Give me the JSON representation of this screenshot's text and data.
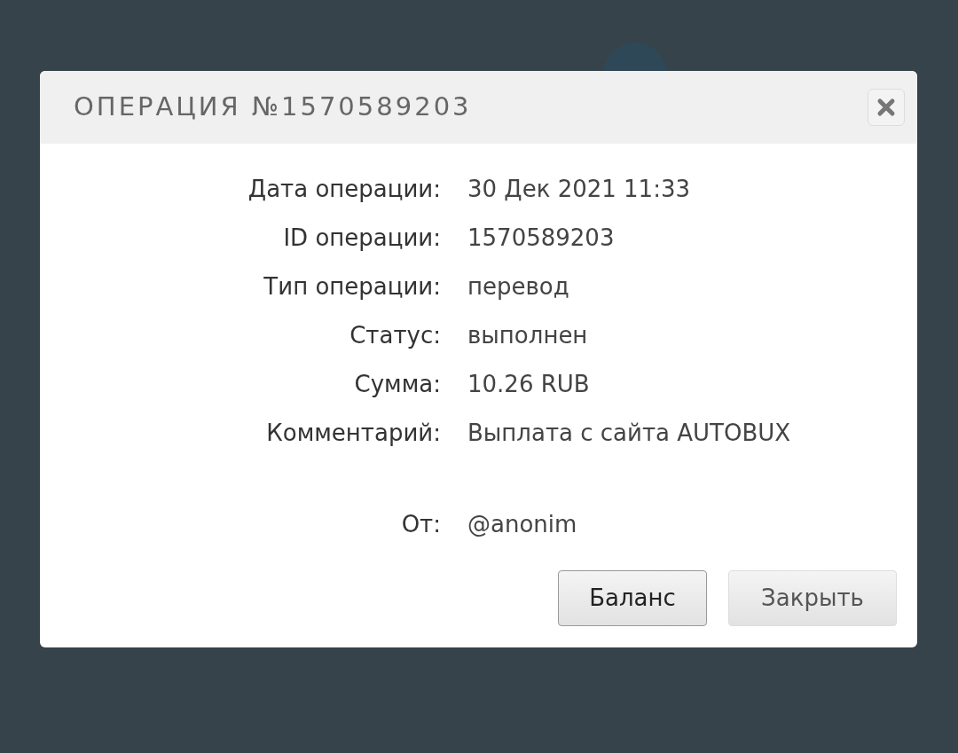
{
  "dialog": {
    "title": "ОПЕРАЦИЯ №1570589203",
    "fields": [
      {
        "label": "Дата операции:",
        "value": "30 Дек 2021 11:33"
      },
      {
        "label": "ID операции:",
        "value": "1570589203"
      },
      {
        "label": "Тип операции:",
        "value": "перевод"
      },
      {
        "label": "Статус:",
        "value": "выполнен"
      },
      {
        "label": "Сумма:",
        "value": "10.26 RUB"
      },
      {
        "label": "Комментарий:",
        "value": "Выплата с сайта AUTOBUX"
      }
    ],
    "sender": {
      "label": "От:",
      "value": "@anonim"
    },
    "buttons": [
      {
        "label": "Баланс",
        "default": true
      },
      {
        "label": "Закрыть",
        "default": false
      }
    ]
  }
}
